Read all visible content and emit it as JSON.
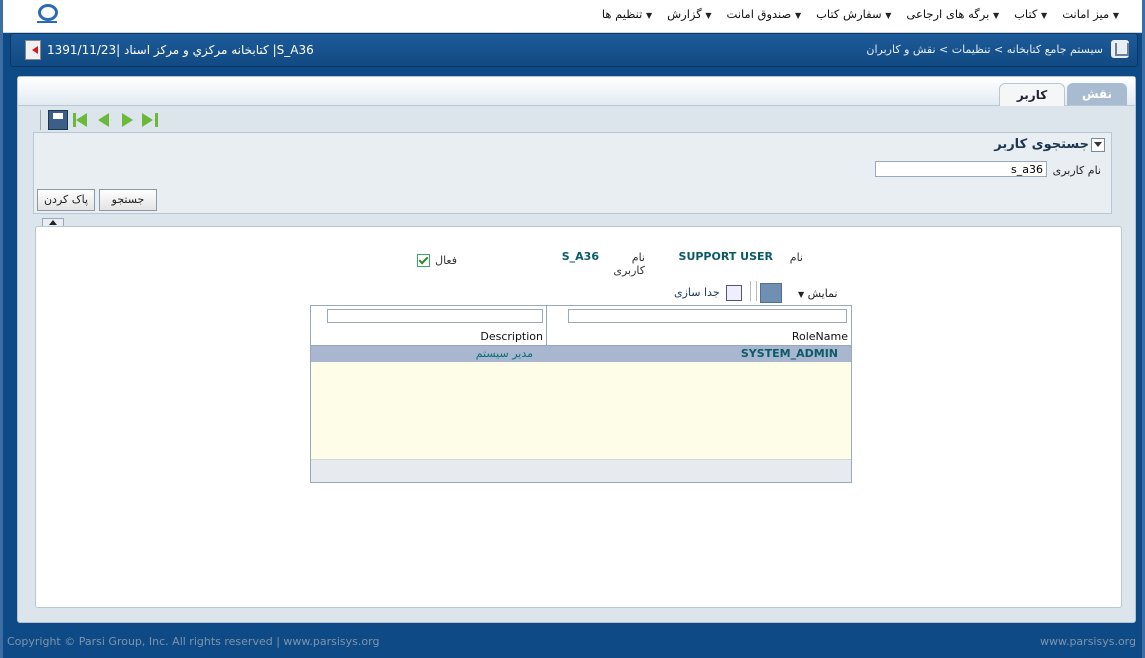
{
  "menu": [
    {
      "label": "میز امانت"
    },
    {
      "label": "کتاب"
    },
    {
      "label": "برگه های ارجاعی"
    },
    {
      "label": "سفارش کتاب"
    },
    {
      "label": "صندوق امانت"
    },
    {
      "label": "گزارش"
    },
    {
      "label": "تنظیم ها"
    }
  ],
  "titlebar": {
    "breadcrumb": "سیستم جامع کتابخانه > تنظیمات > نقش و کاربران",
    "session": "1391/11/23| کتابخانه مرکزي و مرکز اسناد |S_A36"
  },
  "tabs": {
    "role": "نقش",
    "user": "کاربر"
  },
  "search": {
    "title": "جستجوی کاربر",
    "username_label": "نام کاربری",
    "username_value": "s_a36",
    "search_button": "جستجو",
    "clear_button": "پاک کردن"
  },
  "user_info": {
    "name_label": "نام",
    "name_value": "SUPPORT USER",
    "username_label": "نام کاربری",
    "username_value": "S_A36",
    "active_label": "فعال",
    "active": true
  },
  "table_toolbar": {
    "view_label": "نمایش",
    "detach_label": "جدا سازی"
  },
  "grid": {
    "columns": {
      "rolename": "RoleName",
      "description": "Description"
    },
    "rows": [
      {
        "rolename": "SYSTEM_ADMIN",
        "description": "مدیر سیستم"
      }
    ]
  },
  "footer": {
    "copyright": "Copyright © Parsi Group, Inc. All rights reserved | www.parsisys.org",
    "site": "www.parsisys.org"
  }
}
